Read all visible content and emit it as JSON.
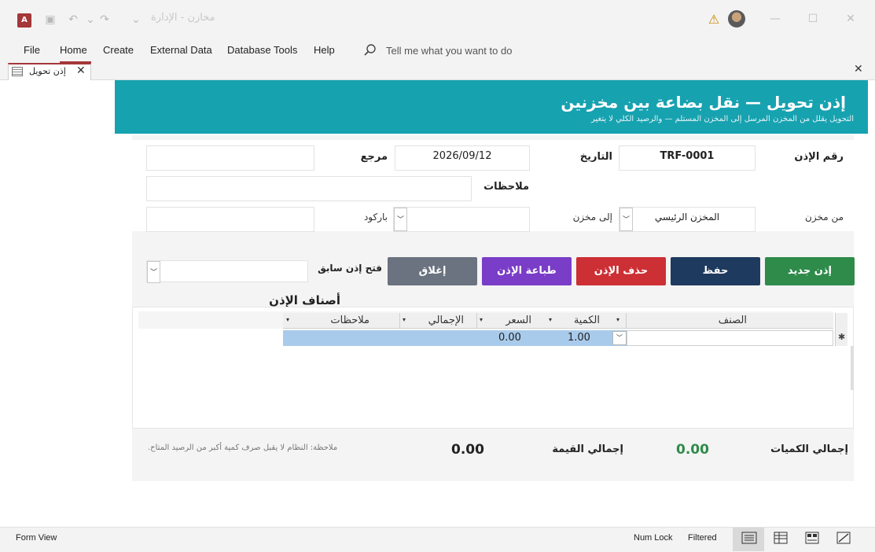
{
  "app": {
    "icon_letter": "A",
    "title": "مخازن - الإدارة"
  },
  "menu": {
    "items": [
      "File",
      "Home",
      "Create",
      "External Data",
      "Database Tools",
      "Help"
    ],
    "search_text": "Tell me what you want to do"
  },
  "doc_tab": {
    "label": "إذن تحويل"
  },
  "header": {
    "title": "إذن تحويل  —  نقل بضاعة بين مخزنين",
    "subtitle": "التحويل يقلل من المخزن المرسل إلى المخزن المستلم — والرصيد الكلي لا يتغير"
  },
  "fields": {
    "doc_no_label": "رقم الإذن",
    "doc_no_value": "TRF-0001",
    "date_label": "التاريخ",
    "date_value": "2026/09/12",
    "ref_label": "مرجع",
    "ref_value": "",
    "notes_label": "ملاحظات",
    "notes_value": "",
    "from_label": "من مخزن",
    "from_value": "المخزن الرئيسي",
    "to_label": "إلى مخزن",
    "to_value": "",
    "barcode_label": "باركود",
    "barcode_value": ""
  },
  "buttons": {
    "new": "إذن جديد",
    "save": "حفظ",
    "delete": "حذف الإذن",
    "print": "طباعة الإذن",
    "close": "إغلاق",
    "open_prev_label": "فتح إذن سابق"
  },
  "colors": {
    "header": "#17a2b0",
    "new": "#2e8b4a",
    "save": "#1f3a5f",
    "delete": "#cc2f34",
    "print": "#7a3dc7",
    "close": "#6b7280",
    "qty_total": "#2e8b4a"
  },
  "subform": {
    "caption": "أصناف الإذن",
    "columns": [
      "الصنف",
      "الكمية",
      "السعر",
      "الإجمالي",
      "ملاحظات"
    ],
    "row": {
      "item": "",
      "qty": "1.00",
      "price": "0.00",
      "total": "",
      "notes": ""
    }
  },
  "totals": {
    "qty_label": "إجمالي الكميات",
    "qty_value": "0.00",
    "value_label": "إجمالي القيمة",
    "value_value": "0.00",
    "note": "ملاحظة: النظام لا يقبل صرف كمية أكبر من الرصيد المتاح."
  },
  "status": {
    "view": "Form View",
    "num_lock": "Num Lock",
    "filtered": "Filtered"
  },
  "icons": [
    "app-icon",
    "save-icon",
    "undo-icon",
    "redo-icon",
    "customize-icon",
    "warning-icon",
    "search-icon",
    "form-view-icon",
    "datasheet-view-icon",
    "layout-view-icon",
    "design-view-icon",
    "close-icon",
    "chevron-down-icon",
    "new-record-icon"
  ]
}
